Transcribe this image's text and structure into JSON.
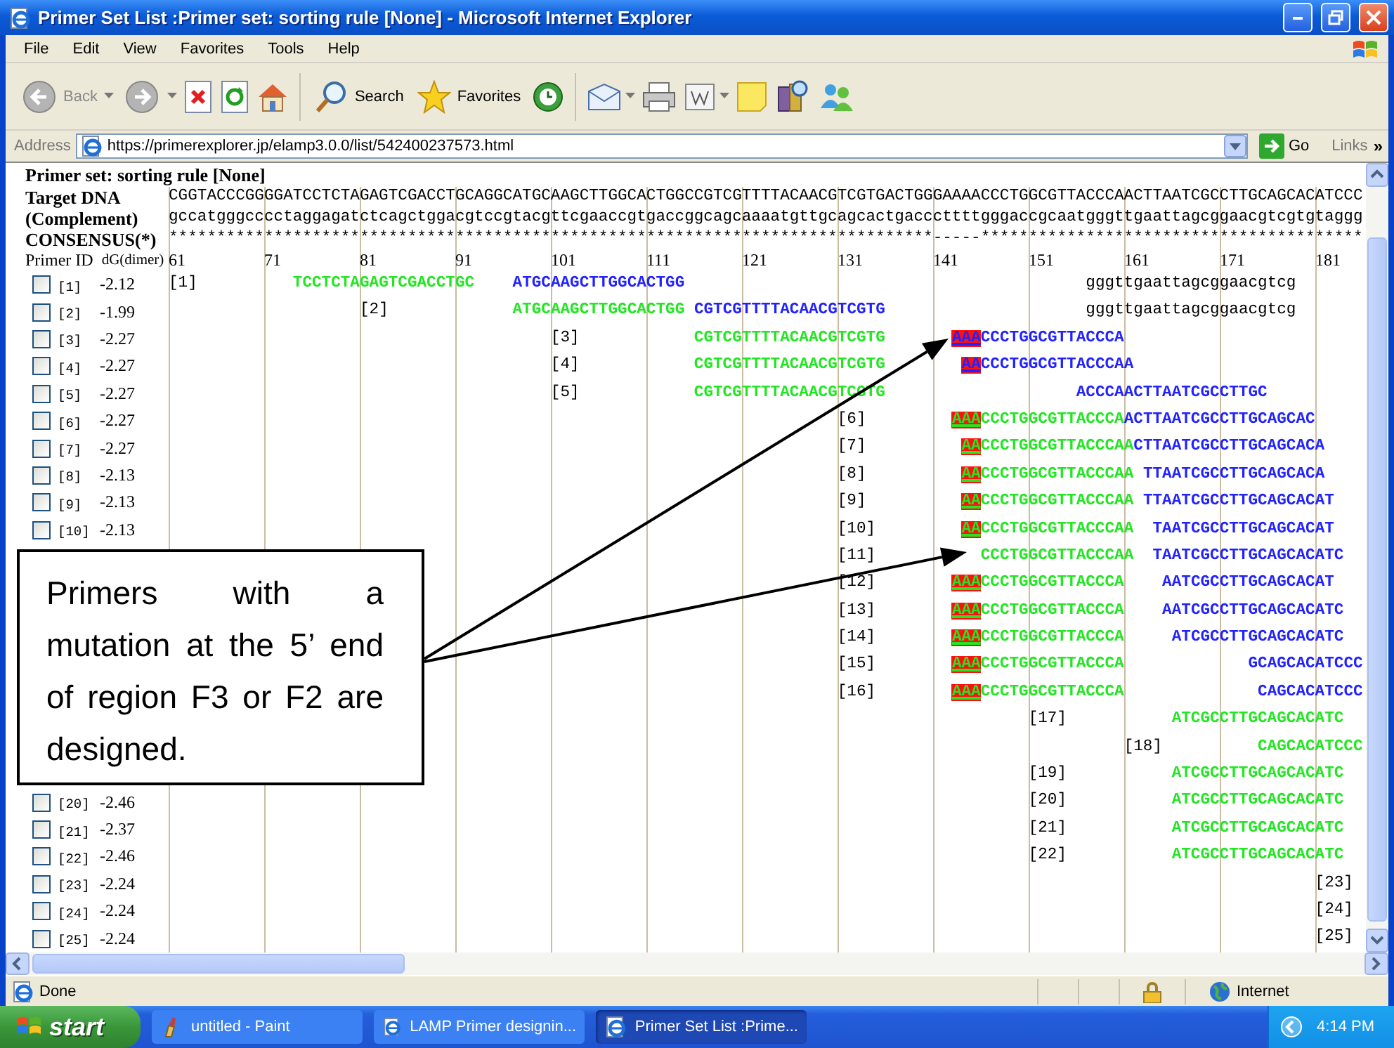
{
  "window": {
    "title": "Primer Set List :Primer set: sorting rule [None] - Microsoft Internet Explorer"
  },
  "menu": [
    "File",
    "Edit",
    "View",
    "Favorites",
    "Tools",
    "Help"
  ],
  "toolbar": {
    "back": "Back",
    "search": "Search",
    "favorites": "Favorites"
  },
  "address": {
    "label": "Address",
    "url": "https://primerexplorer.jp/elamp3.0.0/list/542400237573.html",
    "go": "Go",
    "links": "Links",
    "more": "»"
  },
  "page": {
    "heading": "Primer set: sorting rule [None]",
    "target_label": "Target DNA",
    "target": "CGGTACCCGGGGATCCTCTAGAGTCGACCTGCAGGCATGCAAGCTTGGCACTGGCCGTCGTTTTACAACGTCGTGACTGGGAAAACCCTGGCGTTACCCAACTTAATCGCCTTGCAGCACATCCC",
    "complement_label": "(Complement)",
    "complement": "gccatgggcccctaggagatctcagctggacgtccgtacgttcgaaccgtgaccggcagcaaaatgttgcagcactgacccttttgggaccgcaatgggttgaattagcggaacgtcgtgtaggg",
    "consensus_label": "CONSENSUS(*)",
    "consensus": "********************************************************************************-----****************************************",
    "id_header": "Primer ID",
    "dg_header": "dG(dimer)",
    "ruler": [
      "61",
      "71",
      "81",
      "91",
      "101",
      "111",
      "121",
      "131",
      "141",
      "151",
      "161",
      "171",
      "181"
    ],
    "primers": [
      {
        "checked": false,
        "id": "[1]",
        "dg": "-2.12",
        "segments": [
          {
            "text": "[1]",
            "kind": "label"
          },
          {
            "text": "          TCCTCTAGAGTCGACCTGC",
            "kind": "base",
            "color": "#22e622"
          },
          {
            "text": "    ATGCAAGCTTGGCACTGG",
            "kind": "base",
            "color": "#2222ff"
          },
          {
            "text": "                                          gggttgaattagcggaacgtcg",
            "kind": "template",
            "color": "#000000"
          }
        ]
      },
      {
        "checked": false,
        "id": "[2]",
        "dg": "-1.99",
        "segments": [
          {
            "text": "                    [2]",
            "kind": "label"
          },
          {
            "text": "             ATGCAAGCTTGGCACTGG",
            "kind": "base",
            "color": "#22e622"
          },
          {
            "text": " CGTCGTTTTACAACGTCGTG",
            "kind": "base",
            "color": "#2222ff"
          },
          {
            "text": "                     gggttgaattagcggaacgtcg",
            "kind": "template",
            "color": "#000000"
          }
        ]
      },
      {
        "checked": false,
        "id": "[3]",
        "dg": "-2.27",
        "segments": [
          {
            "text": "                                        [3]",
            "kind": "label"
          },
          {
            "text": "            CGTCGTTTTACAACGTCGTG",
            "kind": "base",
            "color": "#22e622"
          },
          {
            "text": "       AAA",
            "kind": "mutation"
          },
          {
            "text": "CCCTGGCGTTACCCA",
            "kind": "base",
            "color": "#2222ff"
          }
        ]
      },
      {
        "checked": false,
        "id": "[4]",
        "dg": "-2.27",
        "segments": [
          {
            "text": "                                        [4]",
            "kind": "label"
          },
          {
            "text": "            CGTCGTTTTACAACGTCGTG",
            "kind": "base",
            "color": "#22e622"
          },
          {
            "text": "        AA",
            "kind": "mutation"
          },
          {
            "text": "CCCTGGCGTTACCCAA",
            "kind": "base",
            "color": "#2222ff"
          }
        ]
      },
      {
        "checked": false,
        "id": "[5]",
        "dg": "-2.27",
        "segments": [
          {
            "text": "                                        [5]",
            "kind": "label"
          },
          {
            "text": "            CGTCGTTTTACAACGTCGTG",
            "kind": "base",
            "color": "#22e622"
          },
          {
            "text": "                    ACCCAACTTAATCGCCTTGC",
            "kind": "base",
            "color": "#2222ff"
          }
        ]
      },
      {
        "checked": false,
        "id": "[6]",
        "dg": "-2.27",
        "segments": [
          {
            "text": "                                                                      [6]",
            "kind": "label"
          },
          {
            "text": "         AAA",
            "kind": "mutation"
          },
          {
            "text": "CCCTGGCGTTACCCA",
            "kind": "base",
            "color": "#22e622"
          },
          {
            "text": "ACTTAATCGCCTTGCAGCAC",
            "kind": "base",
            "color": "#2222ff"
          }
        ]
      },
      {
        "checked": false,
        "id": "[7]",
        "dg": "-2.27",
        "segments": [
          {
            "text": "                                                                      [7]",
            "kind": "label"
          },
          {
            "text": "          AA",
            "kind": "mutation"
          },
          {
            "text": "CCCTGGCGTTACCCAA",
            "kind": "base",
            "color": "#22e622"
          },
          {
            "text": "CTTAATCGCCTTGCAGCACA",
            "kind": "base",
            "color": "#2222ff"
          }
        ]
      },
      {
        "checked": false,
        "id": "[8]",
        "dg": "-2.13",
        "segments": [
          {
            "text": "                                                                      [8]",
            "kind": "label"
          },
          {
            "text": "          AA",
            "kind": "mutation"
          },
          {
            "text": "CCCTGGCGTTACCCAA",
            "kind": "base",
            "color": "#22e622"
          },
          {
            "text": " TTAATCGCCTTGCAGCACA",
            "kind": "base",
            "color": "#2222ff"
          }
        ]
      },
      {
        "checked": false,
        "id": "[9]",
        "dg": "-2.13",
        "segments": [
          {
            "text": "                                                                      [9]",
            "kind": "label"
          },
          {
            "text": "          AA",
            "kind": "mutation"
          },
          {
            "text": "CCCTGGCGTTACCCAA",
            "kind": "base",
            "color": "#22e622"
          },
          {
            "text": " TTAATCGCCTTGCAGCACAT",
            "kind": "base",
            "color": "#2222ff"
          }
        ]
      },
      {
        "checked": false,
        "id": "[10]",
        "dg": "-2.13",
        "segments": [
          {
            "text": "                                                                      [10]",
            "kind": "label"
          },
          {
            "text": "         AA",
            "kind": "mutation"
          },
          {
            "text": "CCCTGGCGTTACCCAA",
            "kind": "base",
            "color": "#22e622"
          },
          {
            "text": "  TAATCGCCTTGCAGCACAT",
            "kind": "base",
            "color": "#2222ff"
          }
        ]
      },
      {
        "segments": [
          {
            "text": "                                                                      [11]",
            "kind": "label"
          },
          {
            "text": "           CCCTGGCGTTACCCAA",
            "kind": "base",
            "color": "#22e622"
          },
          {
            "text": "  TAATCGCCTTGCAGCACATC",
            "kind": "base",
            "color": "#2222ff"
          }
        ]
      },
      {
        "segments": [
          {
            "text": "                                                                      [12]",
            "kind": "label"
          },
          {
            "text": "        AAA",
            "kind": "mutation"
          },
          {
            "text": "CCCTGGCGTTACCCA",
            "kind": "base",
            "color": "#22e622"
          },
          {
            "text": "    AATCGCCTTGCAGCACAT",
            "kind": "base",
            "color": "#2222ff"
          }
        ]
      },
      {
        "segments": [
          {
            "text": "                                                                      [13]",
            "kind": "label"
          },
          {
            "text": "        AAA",
            "kind": "mutation"
          },
          {
            "text": "CCCTGGCGTTACCCA",
            "kind": "base",
            "color": "#22e622"
          },
          {
            "text": "    AATCGCCTTGCAGCACATC",
            "kind": "base",
            "color": "#2222ff"
          }
        ]
      },
      {
        "segments": [
          {
            "text": "                                                                      [14]",
            "kind": "label"
          },
          {
            "text": "        AAA",
            "kind": "mutation"
          },
          {
            "text": "CCCTGGCGTTACCCA",
            "kind": "base",
            "color": "#22e622"
          },
          {
            "text": "     ATCGCCTTGCAGCACATC",
            "kind": "base",
            "color": "#2222ff"
          }
        ]
      },
      {
        "segments": [
          {
            "text": "                                                                      [15]",
            "kind": "label"
          },
          {
            "text": "        AAA",
            "kind": "mutation"
          },
          {
            "text": "CCCTGGCGTTACCCA",
            "kind": "base",
            "color": "#22e622"
          },
          {
            "text": "             GCAGCACATCCC",
            "kind": "base",
            "color": "#2222ff"
          }
        ]
      },
      {
        "segments": [
          {
            "text": "                                                                      [16]",
            "kind": "label"
          },
          {
            "text": "        AAA",
            "kind": "mutation"
          },
          {
            "text": "CCCTGGCGTTACCCA",
            "kind": "base",
            "color": "#22e622"
          },
          {
            "text": "              CAGCACATCCC",
            "kind": "base",
            "color": "#2222ff"
          }
        ]
      },
      {
        "segments": [
          {
            "text": "                                                                                          [17]",
            "kind": "label"
          },
          {
            "text": "           ATCGCCTTGCAGCACATC",
            "kind": "base",
            "color": "#22e622"
          }
        ]
      },
      {
        "segments": [
          {
            "text": "                                                                                                    [18]",
            "kind": "label"
          },
          {
            "text": "          CAGCACATCCC",
            "kind": "base",
            "color": "#22e622"
          }
        ]
      },
      {
        "segments": [
          {
            "text": "                                                                                          [19]",
            "kind": "label"
          },
          {
            "text": "           ATCGCCTTGCAGCACATC",
            "kind": "base",
            "color": "#22e622"
          }
        ]
      },
      {
        "checked": false,
        "id": "[20]",
        "dg": "-2.46",
        "segments": [
          {
            "text": "                                                                                          [20]",
            "kind": "label"
          },
          {
            "text": "           ATCGCCTTGCAGCACATC",
            "kind": "base",
            "color": "#22e622"
          }
        ]
      },
      {
        "checked": false,
        "id": "[21]",
        "dg": "-2.37",
        "segments": [
          {
            "text": "                                                                                          [21]",
            "kind": "label"
          },
          {
            "text": "           ATCGCCTTGCAGCACATC",
            "kind": "base",
            "color": "#22e622"
          }
        ]
      },
      {
        "checked": false,
        "id": "[22]",
        "dg": "-2.46",
        "segments": [
          {
            "text": "                                                                                          [22]",
            "kind": "label"
          },
          {
            "text": "           ATCGCCTTGCAGCACATC",
            "kind": "base",
            "color": "#22e622"
          }
        ]
      },
      {
        "checked": false,
        "id": "[23]",
        "dg": "-2.24",
        "segments": [
          {
            "text": "                                                                                                                        [23]",
            "kind": "label"
          }
        ]
      },
      {
        "checked": false,
        "id": "[24]",
        "dg": "-2.24",
        "segments": [
          {
            "text": "                                                                                                                        [24]",
            "kind": "label"
          }
        ]
      },
      {
        "checked": false,
        "id": "[25]",
        "dg": "-2.24",
        "segments": [
          {
            "text": "                                                                                                                        [25]",
            "kind": "label"
          }
        ]
      }
    ]
  },
  "callout": {
    "text": "Primers with a mutation at the 5’ end of region F3 or F2 are designed."
  },
  "status_bar": {
    "text": "Done",
    "zone": "Internet"
  },
  "taskbar": {
    "start": "start",
    "tasks": [
      {
        "label": "untitled - Paint",
        "selected": false
      },
      {
        "label": "LAMP Primer designin...",
        "selected": false
      },
      {
        "label": "Primer Set List :Prime...",
        "selected": true
      }
    ],
    "clock": "4:14 PM"
  }
}
